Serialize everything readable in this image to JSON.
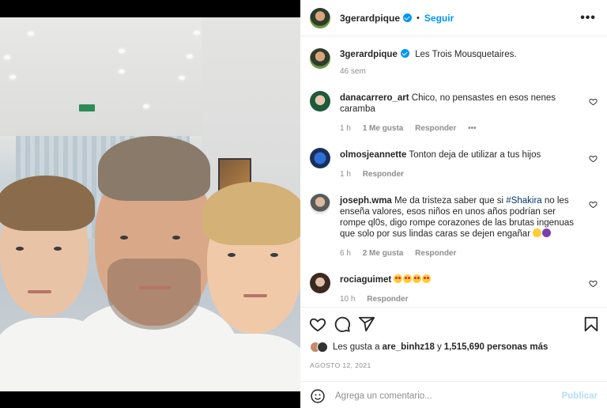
{
  "post": {
    "author": "3gerardpique",
    "follow_label": "Seguir",
    "more_label": "•••",
    "caption_user": "3gerardpique",
    "caption_text": "Les Trois Mousquetaires.",
    "caption_time": "46 sem"
  },
  "comments": [
    {
      "user": "danacarrero_art",
      "text": "Chico, no pensastes en esos nenes caramba",
      "time": "1 h",
      "likes": "1 Me gusta",
      "reply": "Responder",
      "more": "•••"
    },
    {
      "user": "olmosjeannette",
      "text": "Tonton deja de utilizar a tus hijos",
      "time": "1 h",
      "reply": "Responder"
    },
    {
      "user": "joseph.wma",
      "text_before": "Me da tristeza saber que si ",
      "hashtag": "#Shakira",
      "text_after": " no les enseña valores, esos niños en unos años podrían ser rompe ql0s, digo rompe corazones de las brutas ingenuas que solo por sus lindas caras se dejen engañar",
      "time": "6 h",
      "likes": "2 Me gusta",
      "reply": "Responder"
    },
    {
      "user": "rociaguimet",
      "text": "",
      "time": "10 h",
      "reply": "Responder"
    }
  ],
  "likes": {
    "prefix": "Les gusta a ",
    "user": "are_binhz18",
    "middle": " y ",
    "count": "1,515,690 personas más"
  },
  "date": "AGOSTO 12, 2021",
  "comment_box": {
    "placeholder": "Agrega un comentario...",
    "publish_label": "Publicar"
  },
  "icons": {
    "like": "heart-icon",
    "comment": "comment-icon",
    "share": "share-icon",
    "save": "bookmark-icon",
    "emoji": "emoji-icon"
  },
  "colors": {
    "accent": "#0095f6",
    "muted": "#8e8e8e",
    "publish_disabled": "#b2dffc"
  }
}
